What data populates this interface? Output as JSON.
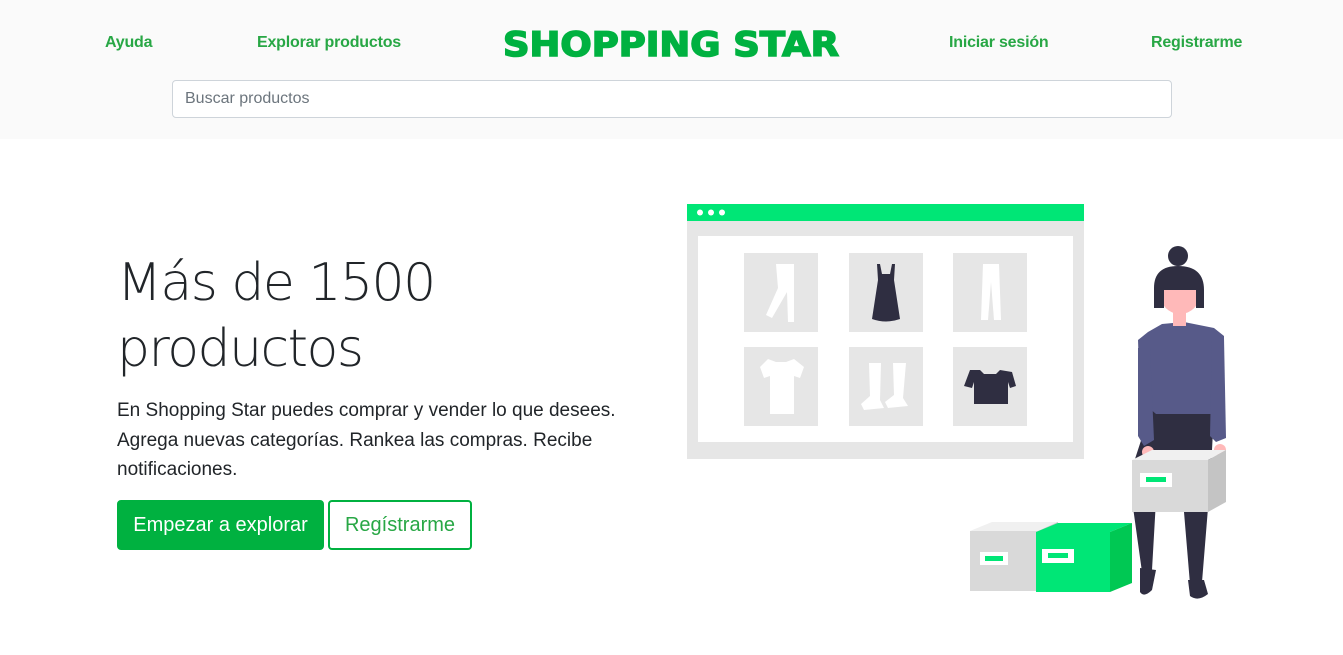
{
  "header": {
    "nav": {
      "help": "Ayuda",
      "explore": "Explorar productos",
      "login": "Iniciar sesión",
      "register": "Registrarme"
    },
    "brand": "SHOPPING STAR",
    "search": {
      "placeholder": "Buscar productos",
      "value": ""
    }
  },
  "hero": {
    "title_line1": "Más de 1500",
    "title_line2": "productos",
    "description": "En Shopping Star puedes comprar y vender lo que desees. Agrega nuevas categorías. Rankea las compras. Recibe notificaciones.",
    "primary_button": "Empezar a explorar",
    "secondary_button": "Regístrarme"
  },
  "illustration": {
    "name": "online-shopping-illustration",
    "items": [
      "pants-icon",
      "dress-icon",
      "trousers-icon",
      "tshirt-icon",
      "socks-icon",
      "sweater-icon"
    ]
  },
  "colors": {
    "accent": "#28a745",
    "brand": "#00b140",
    "browser_bar": "#00e676",
    "header_bg": "#fafafa",
    "shirt": "#575a89",
    "dark": "#2f2e41"
  }
}
